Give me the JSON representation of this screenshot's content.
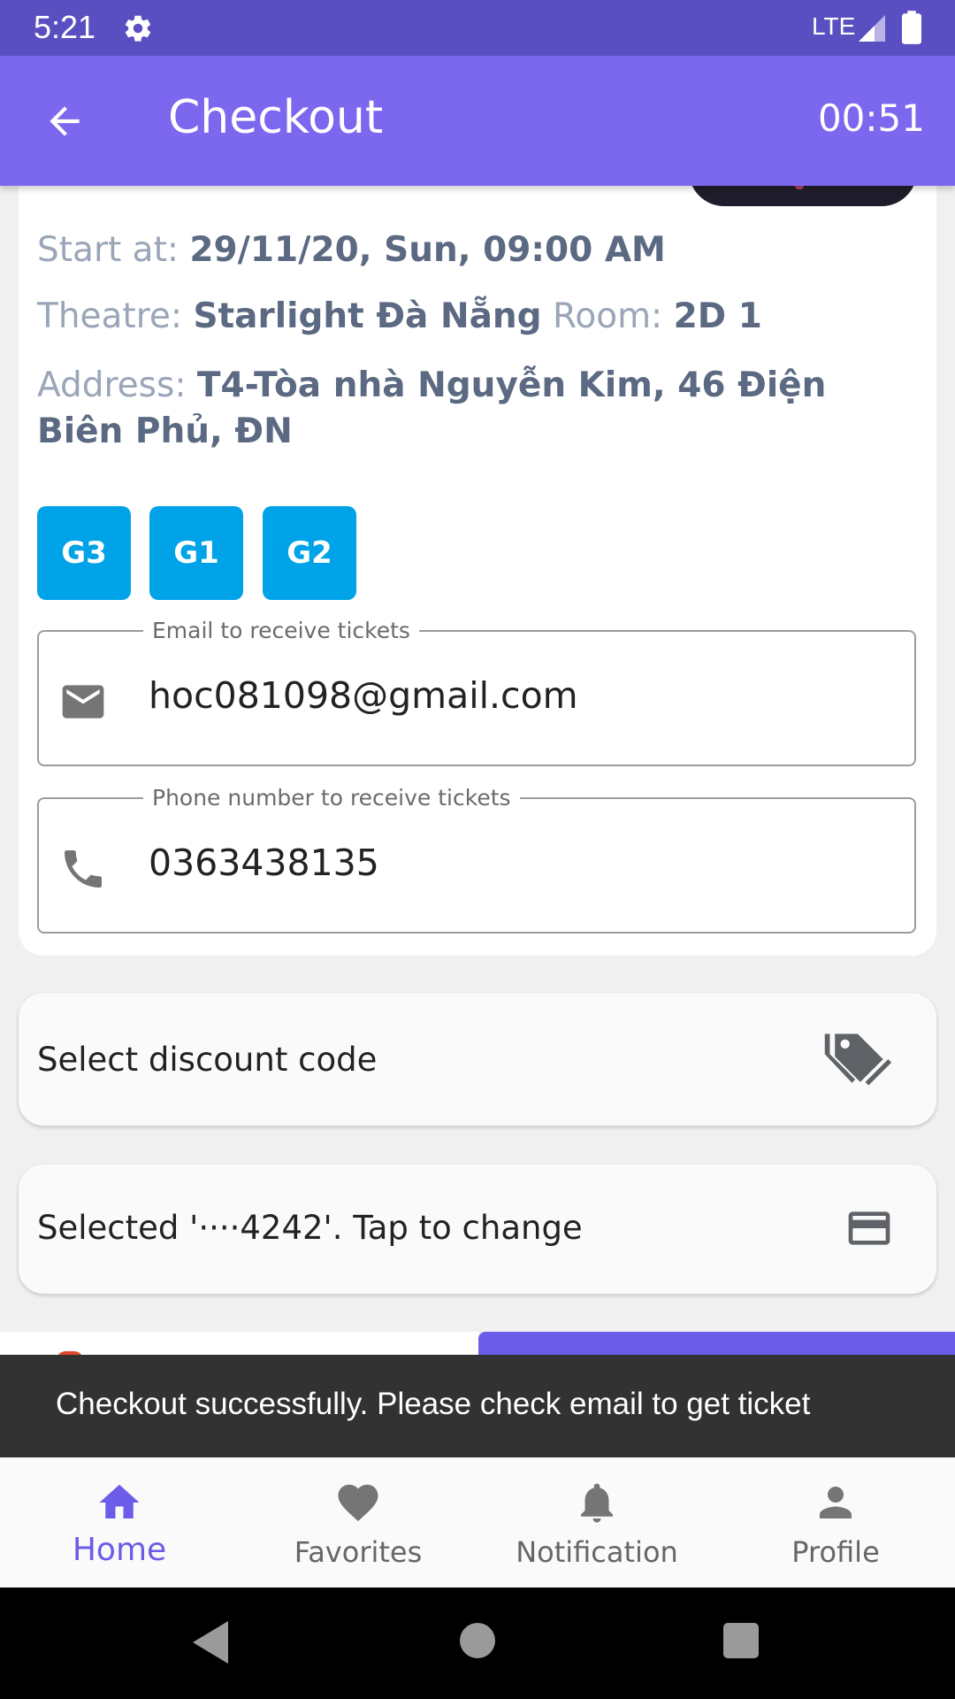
{
  "status_bar": {
    "time": "5:21",
    "network": "LTE"
  },
  "app_bar": {
    "title": "Checkout",
    "timer": "00:51"
  },
  "details": {
    "start_label": "Start at:",
    "start_value": "29/11/20, Sun, 09:00 AM",
    "theatre_label": "Theatre:",
    "theatre_value": "Starlight Đà Nẵng",
    "room_label": "Room:",
    "room_value": "2D 1",
    "address_label": "Address:",
    "address_value": "T4-Tòa nhà Nguyễn Kim, 46 Điện Biên Phủ, ĐN",
    "seats": [
      "G3",
      "G1",
      "G2"
    ]
  },
  "contact": {
    "email_legend": "Email to receive tickets",
    "email_value": "hoc081098@gmail.com",
    "phone_legend": "Phone number to receive tickets",
    "phone_value": "0363438135"
  },
  "discount": {
    "label": "Select discount code"
  },
  "payment": {
    "label": "Selected '····4242'. Tap to change"
  },
  "snackbar": {
    "message": "Checkout successfully. Please check email to get ticket"
  },
  "bottom_nav": {
    "items": [
      {
        "label": "Home",
        "icon": "home-icon",
        "active": true
      },
      {
        "label": "Favorites",
        "icon": "heart-icon",
        "active": false
      },
      {
        "label": "Notification",
        "icon": "bell-icon",
        "active": false
      },
      {
        "label": "Profile",
        "icon": "person-icon",
        "active": false
      }
    ]
  },
  "colors": {
    "status_bar": "#5a4fc1",
    "app_bar": "#7b68ee",
    "seat": "#00a3e8",
    "nav_active": "#6c5ce7",
    "snackbar": "#323232"
  }
}
